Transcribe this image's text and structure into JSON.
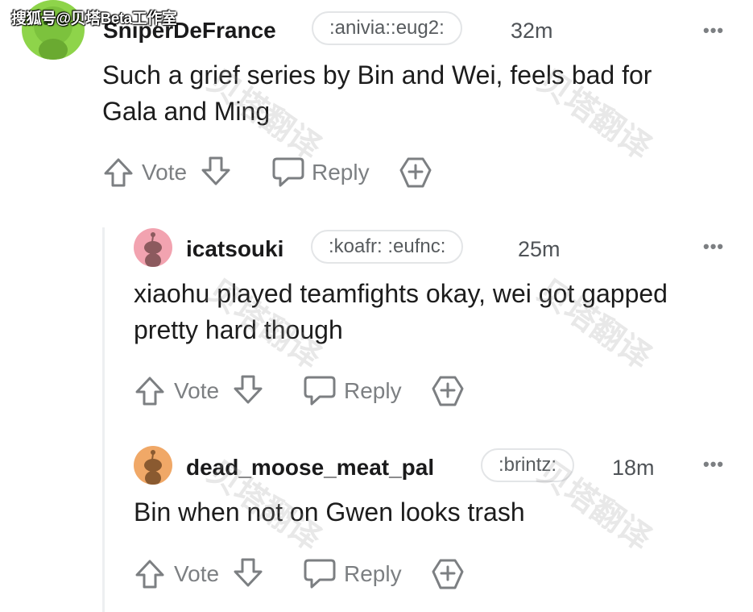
{
  "watermark": {
    "source_label": "搜狐号@贝塔Beta工作室",
    "overlay_text": "贝塔翻译"
  },
  "comments": [
    {
      "username": "SniperDeFrance",
      "flair": ":anivia::eug2:",
      "time": "32m",
      "more": "•••",
      "body": "Such a grief series by Bin and Wei, feels bad for Gala and Ming",
      "body_lines": [
        "Such a grief series by Bin and Wei, feels bad for",
        "Gala and Ming"
      ],
      "vote_label": "Vote",
      "reply_label": "Reply",
      "avatar_color": "#8ed44a"
    },
    {
      "username": "icatsouki",
      "flair": ":koafr: :eufnc:",
      "time": "25m",
      "more": "•••",
      "body": "xiaohu played teamfights okay, wei got gapped pretty hard though",
      "body_lines": [
        "xiaohu played teamfights okay, wei got gapped",
        "pretty hard though"
      ],
      "vote_label": "Vote",
      "reply_label": "Reply",
      "avatar_color": "#f2a3b0"
    },
    {
      "username": "dead_moose_meat_pal",
      "flair": ":brintz:",
      "time": "18m",
      "more": "•••",
      "body": "Bin when not on Gwen looks trash",
      "body_lines": [
        "Bin when not on Gwen looks trash"
      ],
      "vote_label": "Vote",
      "reply_label": "Reply",
      "avatar_color": "#f0a867"
    }
  ],
  "colors": {
    "text": "#1c1c1c",
    "muted": "#7c7f82",
    "thread_line": "#edeff1"
  },
  "icons": [
    "upvote-icon",
    "downvote-icon",
    "reply-icon",
    "award-icon",
    "more-icon"
  ]
}
